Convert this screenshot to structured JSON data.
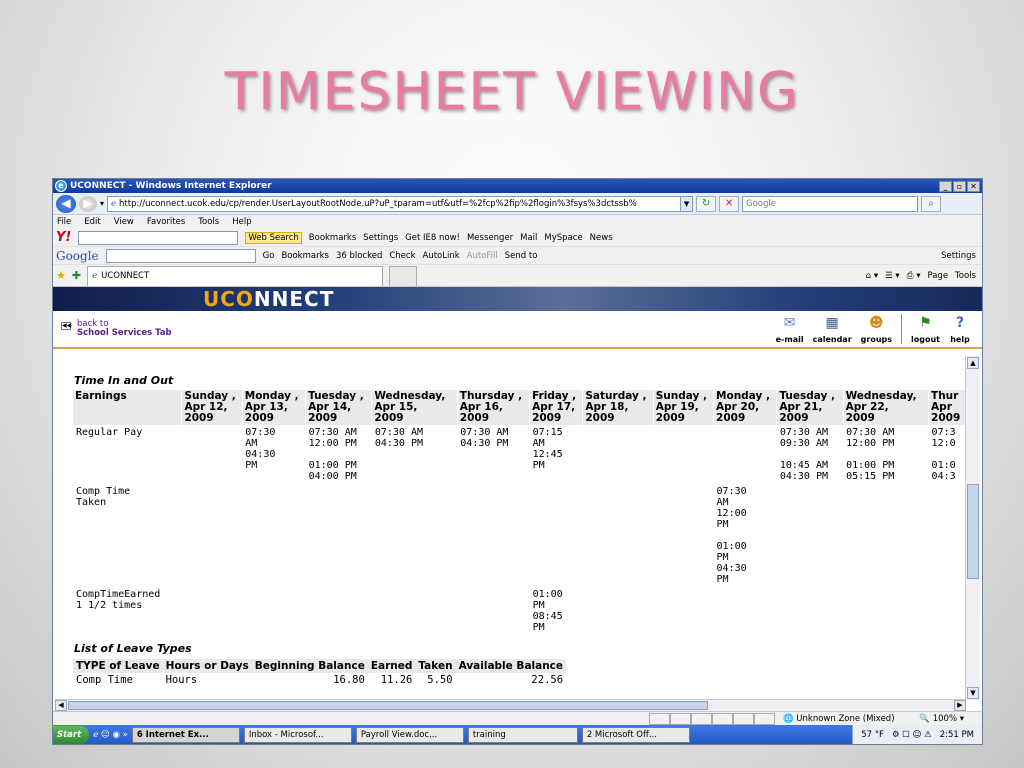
{
  "slide": {
    "title": "TIMESHEET VIEWING"
  },
  "browser": {
    "window_title": "UCONNECT - Windows Internet Explorer",
    "url": "http://uconnect.ucok.edu/cp/render.UserLayoutRootNode.uP?uP_tparam=utf&utf=%2fcp%2fip%2flogin%3fsys%3dctssb%",
    "search_placeholder": "Google",
    "menu": [
      "File",
      "Edit",
      "View",
      "Favorites",
      "Tools",
      "Help"
    ],
    "yahoo_toolbar": [
      "Web Search",
      "Bookmarks",
      "Settings",
      "Get IE8 now!",
      "Messenger",
      "Mail",
      "MySpace",
      "News"
    ],
    "google_toolbar": [
      "Go",
      "Bookmarks",
      "36 blocked",
      "Check",
      "AutoLink",
      "AutoFill",
      "Send to",
      "Settings"
    ],
    "tab_label": "UCONNECT",
    "fav_right": [
      "Page",
      "Tools"
    ]
  },
  "portal": {
    "logo_a": "UCO",
    "logo_b": "NNECT",
    "back_line1": "back to",
    "back_line2": "School Services Tab",
    "nav": [
      {
        "label": "e-mail",
        "icon": "email-icon"
      },
      {
        "label": "calendar",
        "icon": "calendar-icon"
      },
      {
        "label": "groups",
        "icon": "groups-icon"
      },
      {
        "label": "logout",
        "icon": "logout-icon"
      },
      {
        "label": "help",
        "icon": "help-icon"
      }
    ]
  },
  "timesheet": {
    "heading": "Time In and Out",
    "headers": [
      "Earnings",
      "Sunday ,\nApr 12,\n2009",
      "Monday ,\nApr 13,\n2009",
      "Tuesday ,\nApr 14,\n2009",
      "Wednesday,\nApr 15,\n2009",
      "Thursday ,\nApr 16,\n2009",
      "Friday ,\nApr 17,\n2009",
      "Saturday ,\nApr 18,\n2009",
      "Sunday ,\nApr 19,\n2009",
      "Monday ,\nApr 20,\n2009",
      "Tuesday ,\nApr 21,\n2009",
      "Wednesday,\nApr 22,\n2009",
      "Thur\nApr\n2009"
    ],
    "rows": [
      {
        "label": "Regular Pay",
        "cells": [
          "",
          "07:30\nAM\n04:30\nPM",
          "07:30 AM\n12:00 PM\n\n01:00 PM\n04:00 PM",
          "07:30 AM\n04:30 PM",
          "07:30 AM\n04:30 PM",
          "07:15\nAM\n12:45\nPM",
          "",
          "",
          "",
          "07:30 AM\n09:30 AM\n\n10:45 AM\n04:30 PM",
          "07:30 AM\n12:00 PM\n\n01:00 PM\n05:15 PM",
          "07:3\n12:0\n\n01:0\n04:3"
        ]
      },
      {
        "label": "Comp Time\nTaken",
        "cells": [
          "",
          "",
          "",
          "",
          "",
          "",
          "",
          "",
          "07:30\nAM\n12:00\nPM\n\n01:00\nPM\n04:30\nPM",
          "",
          "",
          ""
        ]
      },
      {
        "label": "CompTimeEarned\n1 1/2 times",
        "cells": [
          "",
          "",
          "",
          "",
          "",
          "01:00\nPM\n08:45\nPM",
          "",
          "",
          "",
          "",
          "",
          ""
        ]
      }
    ]
  },
  "leave": {
    "heading": "List of Leave Types",
    "headers": [
      "TYPE of Leave",
      "Hours or Days",
      "Beginning Balance",
      "Earned",
      "Taken",
      "Available Balance"
    ],
    "rows": [
      [
        "Comp Time",
        "Hours",
        "16.80",
        "11.26",
        "5.50",
        "22.56"
      ]
    ]
  },
  "status": {
    "zone": "Unknown Zone (Mixed)",
    "zoom": "100%"
  },
  "taskbar": {
    "start": "Start",
    "tasks": [
      "6 Internet Ex...",
      "Inbox - Microsof...",
      "Payroll View.doc...",
      "training",
      "2 Microsoft Off..."
    ],
    "temp": "57 °F",
    "clock": "2:51 PM"
  }
}
